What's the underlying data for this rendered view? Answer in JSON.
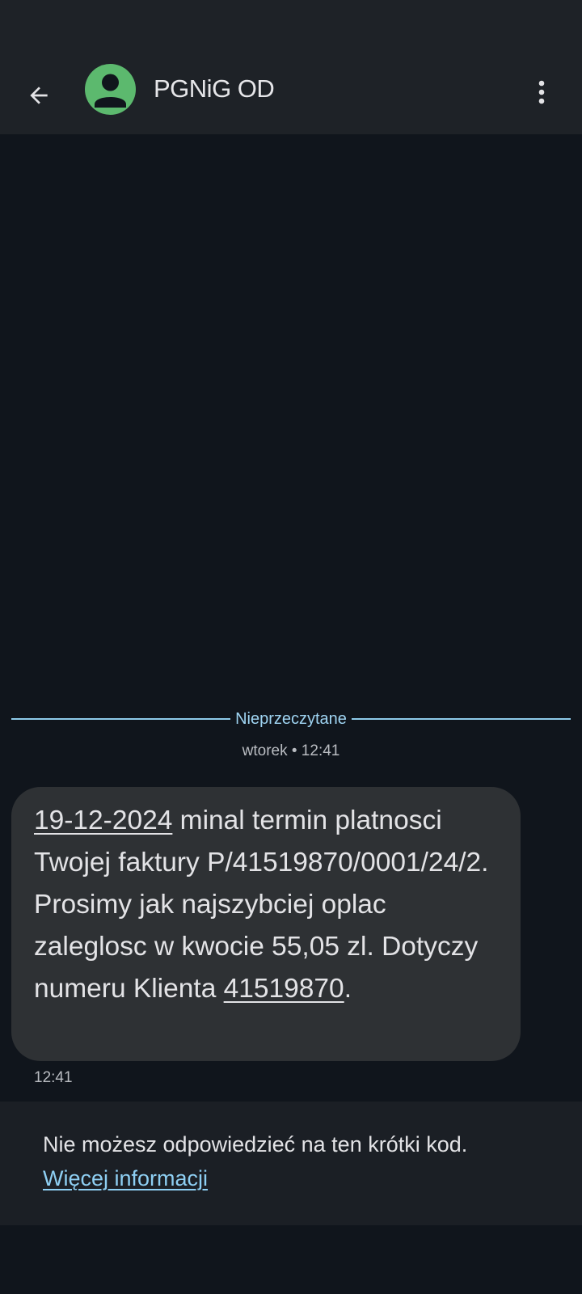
{
  "header": {
    "contact_name": "PGNiG OD",
    "back_icon": "arrow-back-icon",
    "more_icon": "more-vertical-icon",
    "avatar_icon": "person-icon",
    "avatar_color": "#5cb96e"
  },
  "conversation": {
    "unread_label": "Nieprzeczytane",
    "date_header": "wtorek • 12:41",
    "message": {
      "date_link": "19-12-2024",
      "text_part1": " minal termin platnosci Twojej faktury P/41519870/0001/24/2. Prosimy jak najszybciej oplac zaleglosc w kwocie 55,05 zl. Dotyczy numeru Klienta ",
      "client_number_link": "41519870",
      "text_part2": ".",
      "time": "12:41"
    }
  },
  "footer": {
    "notice": "Nie możesz odpowiedzieć na ten krótki kod.",
    "more_info_link": "Więcej informacji"
  },
  "colors": {
    "background": "#10151c",
    "app_bar": "#1e2227",
    "bubble": "#2e3134",
    "accent_link": "#8ecff3"
  }
}
